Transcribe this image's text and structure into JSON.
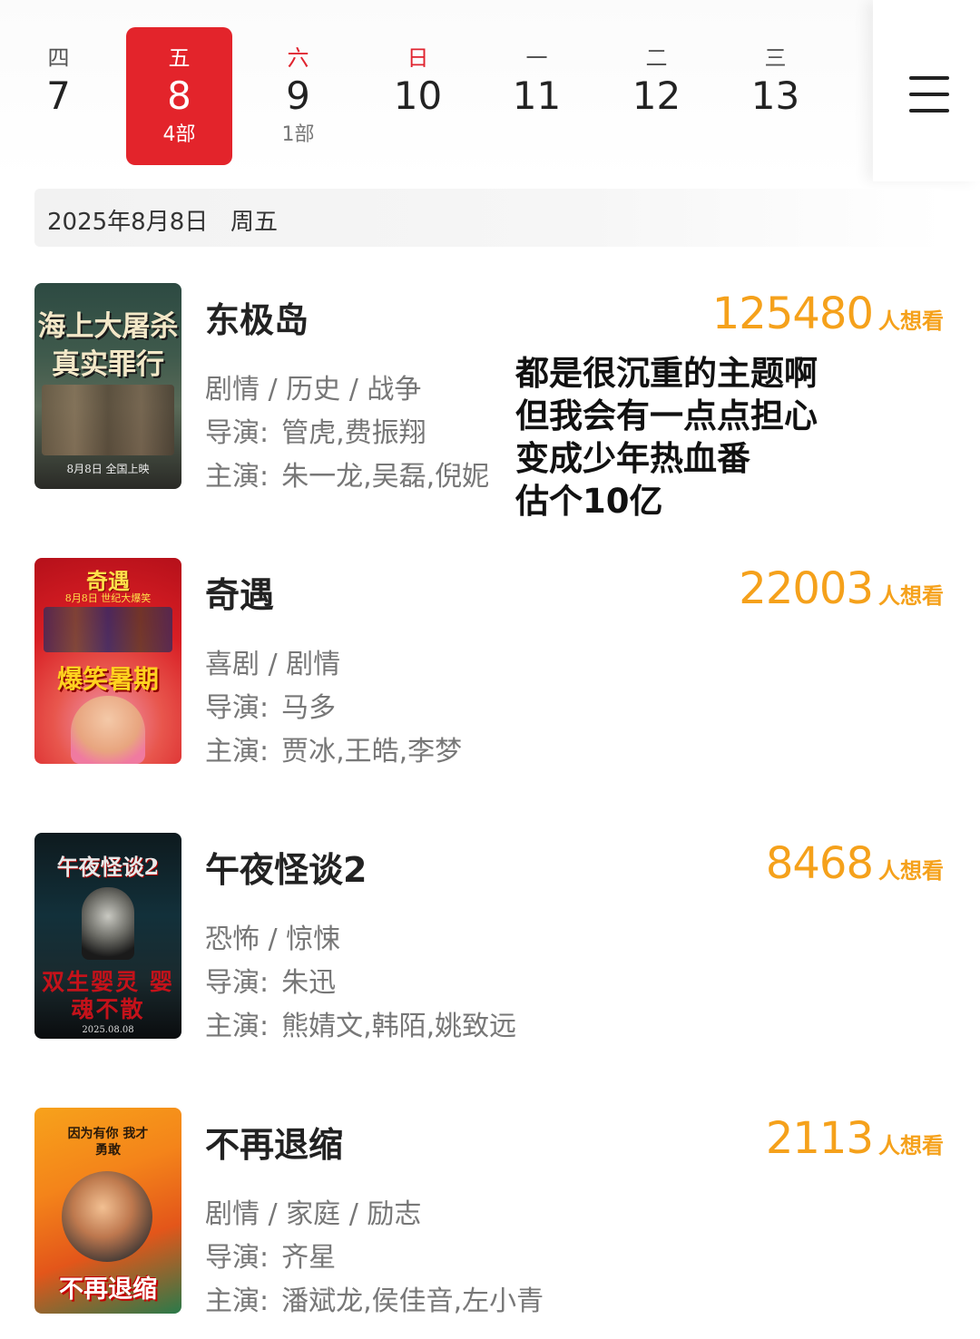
{
  "calendar": {
    "days": [
      {
        "weekday": "四",
        "date": "7",
        "count": ""
      },
      {
        "weekday": "五",
        "date": "8",
        "count": "4部"
      },
      {
        "weekday": "六",
        "date": "9",
        "count": "1部"
      },
      {
        "weekday": "日",
        "date": "10",
        "count": ""
      },
      {
        "weekday": "一",
        "date": "11",
        "count": ""
      },
      {
        "weekday": "二",
        "date": "12",
        "count": ""
      },
      {
        "weekday": "三",
        "date": "13",
        "count": ""
      }
    ],
    "selected_index": 1,
    "selected_color": "#e3242b",
    "weekend_color": "#e0242f"
  },
  "date_header": "2025年8月8日   周五",
  "want_unit": "人想看",
  "labels": {
    "director": "导演:",
    "cast": "主演:"
  },
  "movies": [
    {
      "title": "东极岛",
      "want": "125480",
      "genres": "剧情 / 历史 / 战争",
      "director": "管虎,费振翔",
      "cast": "朱一龙,吴磊,倪妮",
      "poster_text": [
        "海上大屠杀",
        "真实罪行",
        "8月8日 全国上映"
      ]
    },
    {
      "title": "奇遇",
      "want": "22003",
      "genres": "喜剧 / 剧情",
      "director": "马多",
      "cast": "贾冰,王皓,李梦",
      "poster_text": [
        "奇遇",
        "8月8日 世纪大爆笑",
        "爆笑暑期"
      ]
    },
    {
      "title": "午夜怪谈2",
      "want": "8468",
      "genres": "恐怖 / 惊悚",
      "director": "朱迅",
      "cast": "熊婧文,韩陌,姚致远",
      "poster_text": [
        "午夜怪谈2",
        "双生婴灵 婴魂不散",
        "2025.08.08"
      ]
    },
    {
      "title": "不再退缩",
      "want": "2113",
      "genres": "剧情 / 家庭 / 励志",
      "director": "齐星",
      "cast": "潘斌龙,侯佳音,左小青",
      "poster_text": [
        "因为有你 我才勇敢",
        "不再退缩"
      ]
    }
  ],
  "comment": [
    "都是很沉重的主题啊",
    "但我会有一点点担心",
    "变成少年热血番",
    "估个10亿"
  ],
  "accent_color": "#f5a11b"
}
